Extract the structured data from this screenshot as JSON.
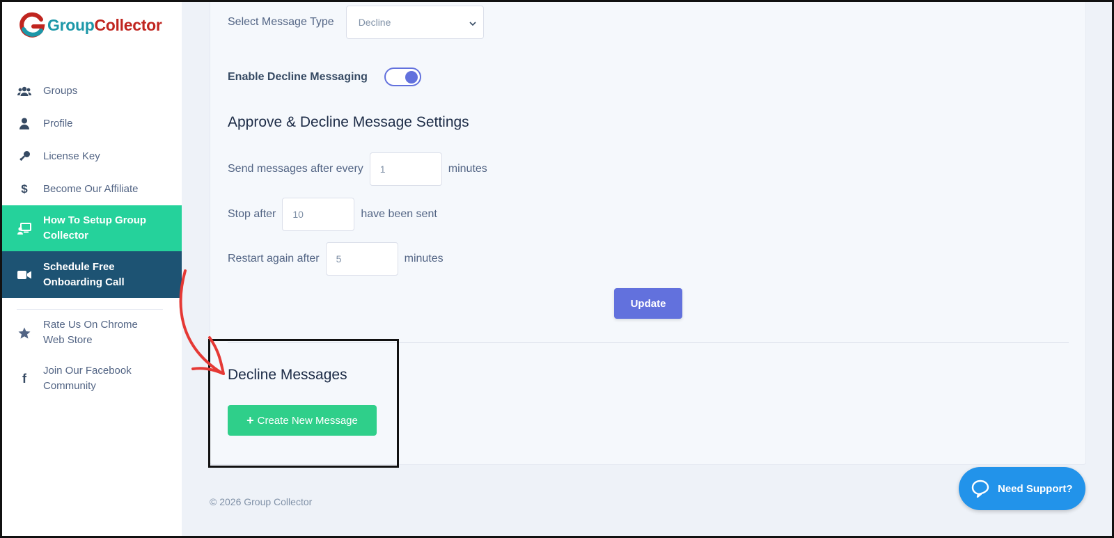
{
  "brand": {
    "logo_part1": "Group",
    "logo_part2": "Collector",
    "colors": {
      "group": "#1c97a8",
      "collector": "#c0251f"
    }
  },
  "sidebar": {
    "items": [
      {
        "label": "Groups",
        "icon": "users-icon"
      },
      {
        "label": "Profile",
        "icon": "user-icon"
      },
      {
        "label": "License Key",
        "icon": "key-icon"
      },
      {
        "label": "Become Our Affiliate",
        "icon": "dollar-icon"
      },
      {
        "label_line1": "How To Setup Group",
        "label_line2": "Collector",
        "icon": "presentation-icon",
        "active": true
      },
      {
        "label_line1": "Schedule Free",
        "label_line2": "Onboarding Call",
        "icon": "video-icon"
      },
      {
        "label_line1": "Rate Us On Chrome",
        "label_line2": "Web Store",
        "icon": "star-icon"
      },
      {
        "label_line1": "Join Our Facebook",
        "label_line2": "Community",
        "icon": "facebook-icon"
      }
    ]
  },
  "settings": {
    "message_type_label": "Select Message Type",
    "message_type_value": "Decline",
    "enable_label": "Enable Decline Messaging",
    "enabled": true,
    "section_title": "Approve & Decline Message Settings",
    "send_prefix": "Send messages after every",
    "send_value": "1",
    "send_suffix": "minutes",
    "stop_prefix": "Stop after",
    "stop_value": "10",
    "stop_suffix": "have been sent",
    "restart_prefix": "Restart again after",
    "restart_value": "5",
    "restart_suffix": "minutes",
    "update_label": "Update"
  },
  "decline": {
    "title": "Decline Messages",
    "create_label": "Create New Message"
  },
  "footer": {
    "copyright": "© 2026 Group Collector"
  },
  "support": {
    "label": "Need Support?"
  },
  "colors": {
    "accent": "#6271dd",
    "active_nav": "#25d29b",
    "dark_nav": "#1d5373",
    "create_button": "#2fcf8a",
    "support_button": "#2293ea",
    "annotation_arrow": "#e53935"
  }
}
